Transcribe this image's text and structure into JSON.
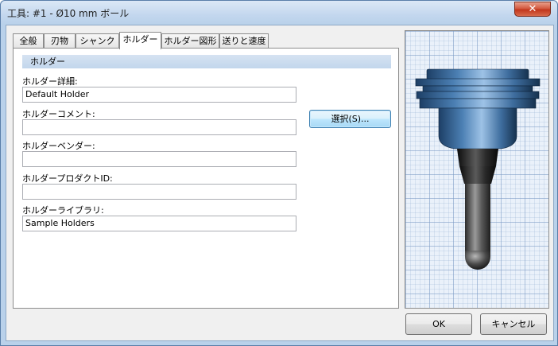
{
  "window": {
    "title": "工具: #1 - Ø10 mm ボール",
    "close_label": "✕"
  },
  "tabs": [
    {
      "label": "全般"
    },
    {
      "label": "刃物"
    },
    {
      "label": "シャンク"
    },
    {
      "label": "ホルダー"
    },
    {
      "label": "ホルダー図形"
    },
    {
      "label": "送りと速度"
    }
  ],
  "active_tab": "ホルダー",
  "panel": {
    "section_title": "ホルダー",
    "fields": [
      {
        "label": "ホルダー詳細:",
        "value": "Default Holder"
      },
      {
        "label": "ホルダーコメント:",
        "value": ""
      },
      {
        "label": "ホルダーベンダー:",
        "value": ""
      },
      {
        "label": "ホルダープロダクトID:",
        "value": ""
      },
      {
        "label": "ホルダーライブラリ:",
        "value": "Sample Holders"
      }
    ],
    "select_button": "選択(S)..."
  },
  "buttons": {
    "ok": "OK",
    "cancel": "キャンセル"
  }
}
